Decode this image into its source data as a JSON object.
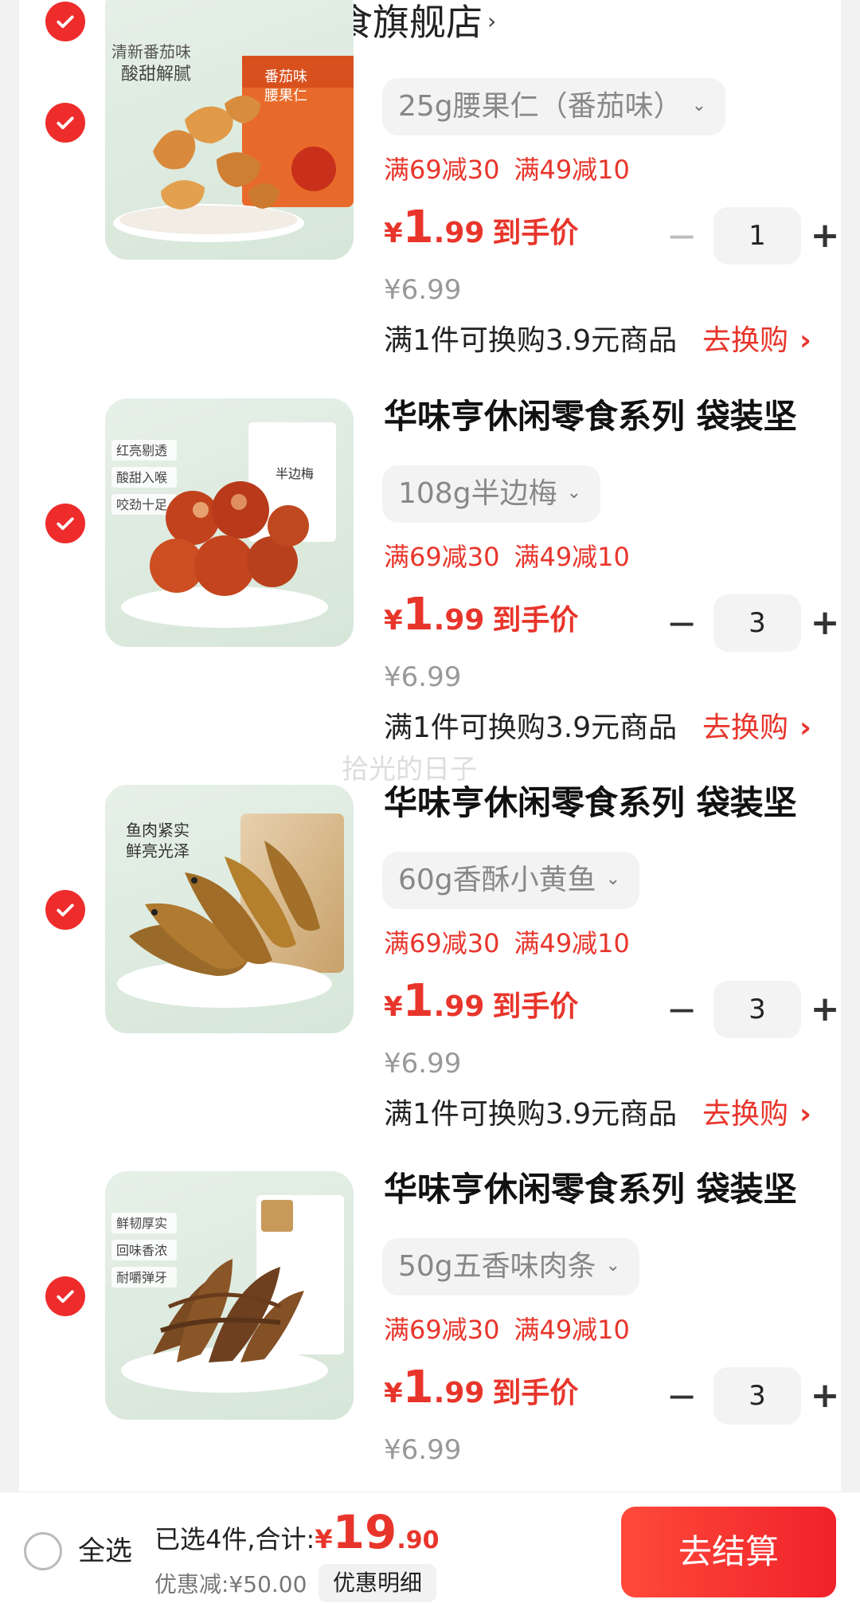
{
  "shop": {
    "name": "华味亨休闲零食旗舰店",
    "arrow": "›"
  },
  "watermark": "拾光的日子",
  "items": [
    {
      "title": "",
      "sku": "25g腰果仁（番茄味）",
      "promos": [
        "满69减30",
        "满49减10"
      ],
      "price": {
        "yen": "¥",
        "int": "1",
        "dec": ".99",
        "label": "到手价"
      },
      "original_price": "¥6.99",
      "quantity": "1",
      "minus_disabled": true,
      "exchange": "满1件可换购3.9元商品",
      "exchange_link": "去换购",
      "thumb_text": [
        "清新番茄味",
        "酸甜解腻",
        "番茄味",
        "腰果仁"
      ]
    },
    {
      "title": "华味亨休闲零食系列 袋装坚",
      "sku": "108g半边梅",
      "promos": [
        "满69减30",
        "满49减10"
      ],
      "price": {
        "yen": "¥",
        "int": "1",
        "dec": ".99",
        "label": "到手价"
      },
      "original_price": "¥6.99",
      "quantity": "3",
      "minus_disabled": false,
      "exchange": "满1件可换购3.9元商品",
      "exchange_link": "去换购",
      "thumb_text": [
        "红亮剔透",
        "酸甜入喉",
        "咬劲十足",
        "半边梅"
      ]
    },
    {
      "title": "华味亨休闲零食系列 袋装坚",
      "sku": "60g香酥小黄鱼",
      "promos": [
        "满69减30",
        "满49减10"
      ],
      "price": {
        "yen": "¥",
        "int": "1",
        "dec": ".99",
        "label": "到手价"
      },
      "original_price": "¥6.99",
      "quantity": "3",
      "minus_disabled": false,
      "exchange": "满1件可换购3.9元商品",
      "exchange_link": "去换购",
      "thumb_text": [
        "鱼肉紧实",
        "鲜亮光泽"
      ]
    },
    {
      "title": "华味亨休闲零食系列 袋装坚",
      "sku": "50g五香味肉条",
      "promos": [
        "满69减30",
        "满49减10"
      ],
      "price": {
        "yen": "¥",
        "int": "1",
        "dec": ".99",
        "label": "到手价"
      },
      "original_price": "¥6.99",
      "quantity": "3",
      "minus_disabled": false,
      "exchange": "",
      "exchange_link": "",
      "thumb_text": [
        "鲜韧厚实",
        "回味香浓",
        "耐嚼弹牙"
      ]
    }
  ],
  "bottom": {
    "select_all": "全选",
    "selected_text": "已选4件,合计:",
    "total_yen": "¥",
    "total_int": "19",
    "total_dec": ".90",
    "discount": "优惠减:¥50.00",
    "detail": "优惠明细",
    "checkout": "去结算"
  },
  "colors": {
    "accent": "#e8352b",
    "check": "#ee2c2c"
  },
  "icons": {
    "check": "check-icon",
    "chevron": "chevron-down-icon",
    "arrow": "chevron-right-icon"
  }
}
